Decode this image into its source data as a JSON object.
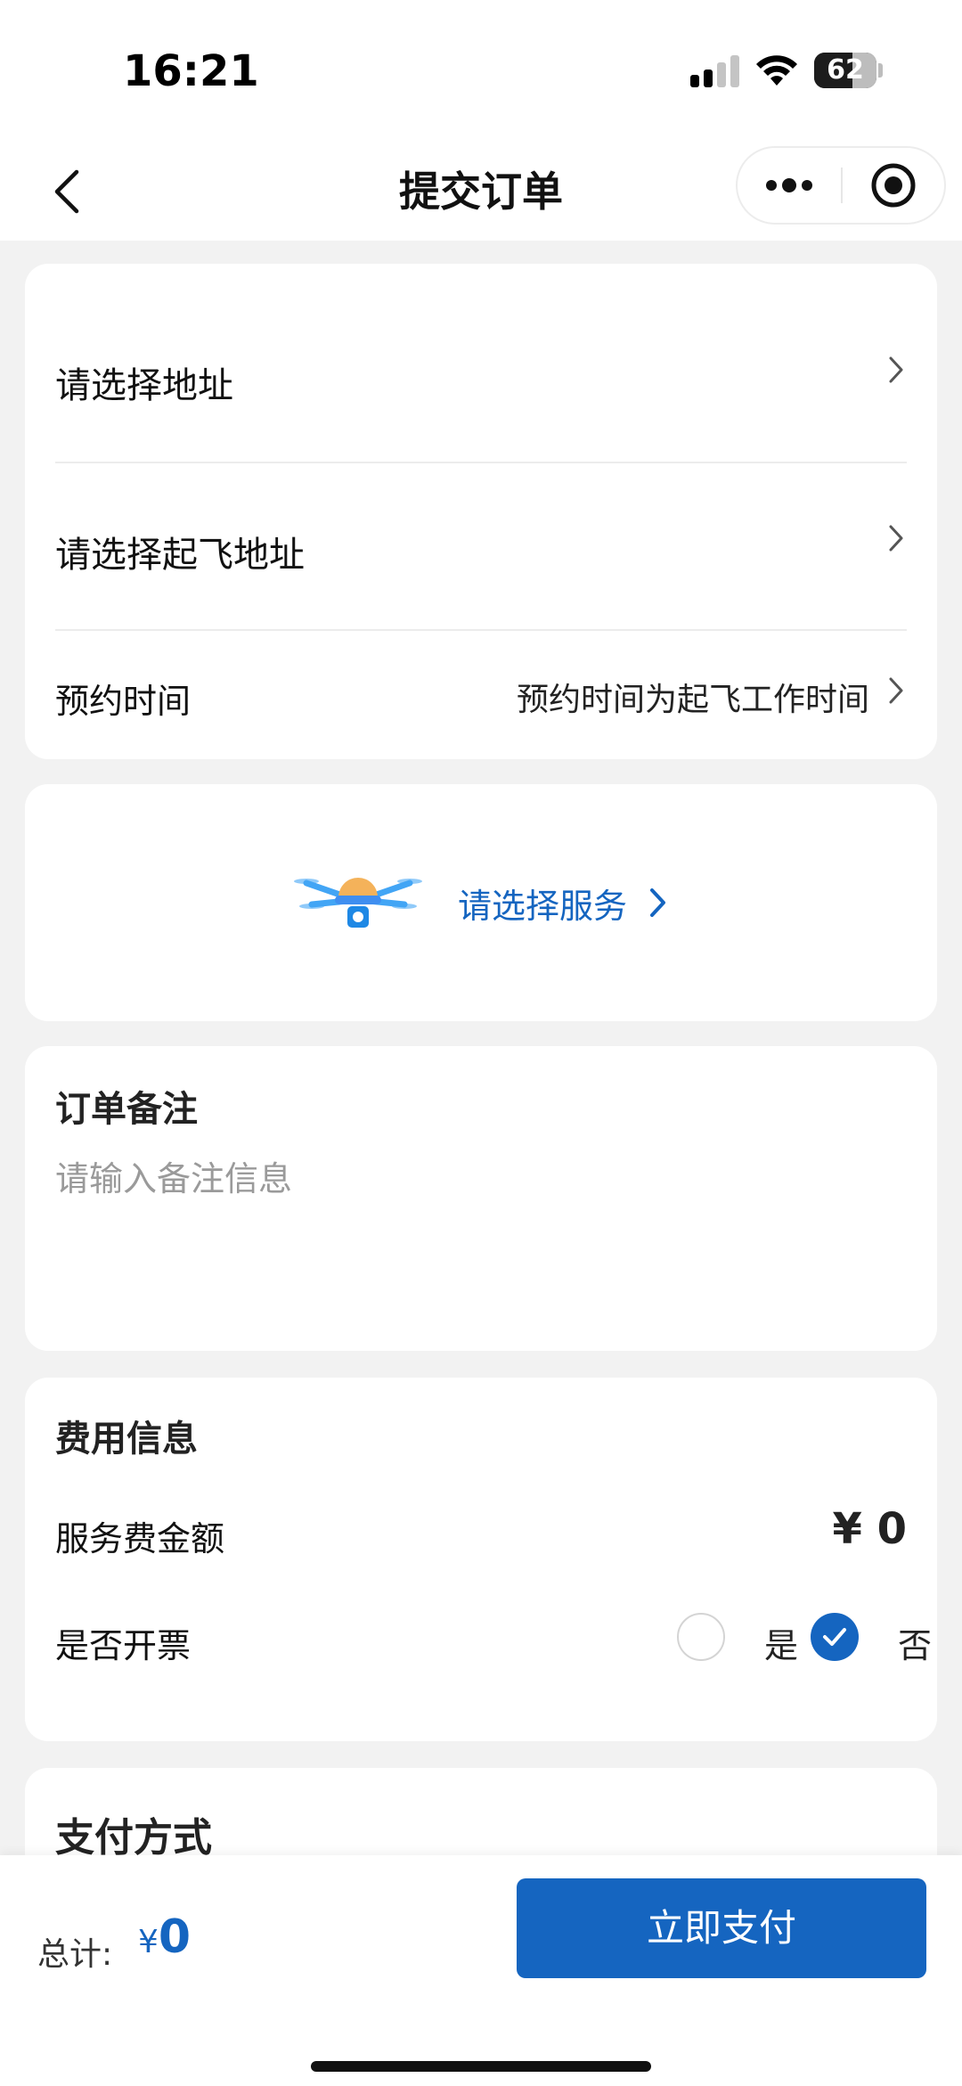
{
  "status_bar": {
    "time": "16:21",
    "battery": "62"
  },
  "nav": {
    "title": "提交订单"
  },
  "address_card": {
    "address_label": "请选择地址",
    "takeoff_label": "请选择起飞地址",
    "appointment_label": "预约时间",
    "appointment_value": "预约时间为起飞工作时间"
  },
  "service": {
    "label": "请选择服务"
  },
  "remark": {
    "title": "订单备注",
    "placeholder": "请输入备注信息"
  },
  "fee": {
    "title": "费用信息",
    "service_fee_label": "服务费金额",
    "service_fee_value": "¥ 0",
    "invoice_label": "是否开票",
    "invoice_yes": "是",
    "invoice_no": "否",
    "invoice_selected": "否"
  },
  "payment": {
    "title": "支付方式"
  },
  "footer": {
    "total_label": "总计:",
    "currency": "¥",
    "total": "0",
    "pay_button": "立即支付"
  },
  "colors": {
    "accent": "#1565c0",
    "background": "#f2f2f2"
  }
}
